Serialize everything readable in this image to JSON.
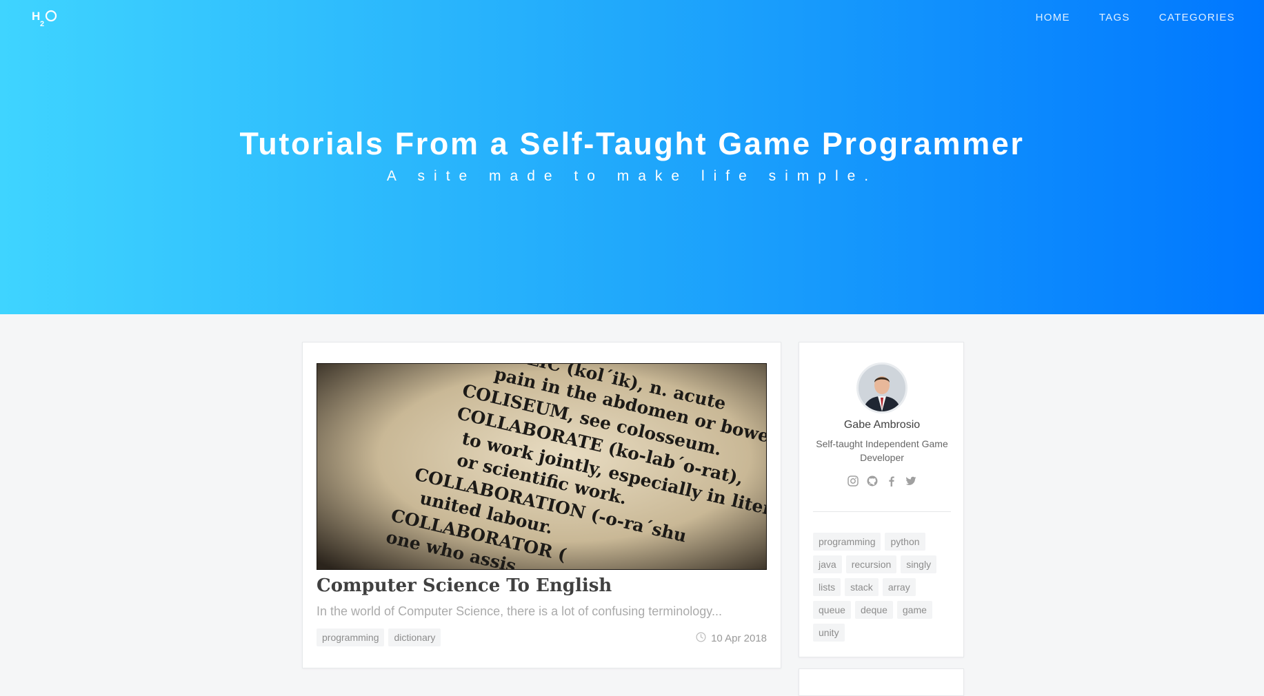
{
  "header": {
    "logo_label": "H2O",
    "nav": [
      {
        "label": "HOME"
      },
      {
        "label": "TAGS"
      },
      {
        "label": "CATEGORIES"
      }
    ],
    "title": "Tutorials From a Self-Taught Game Programmer",
    "subtitle": "A site made to make life simple.",
    "gradient": [
      "#3fd4ff",
      "#0077ff"
    ]
  },
  "post": {
    "image_lines": [
      "COLIC (kol´ik), n. acute",
      "pain in the abdomen or bowels",
      "COLISEUM, see colosseum.",
      "COLLABORATE (ko-lab´o-rat),",
      "to work jointly, especially in liter",
      "or scientific work.",
      "COLLABORATION (-o-ra´shu",
      "united labour.",
      "COLLABORATOR (",
      "one who assis"
    ],
    "title": "Computer Science To English",
    "excerpt": "In the world of Computer Science, there is a lot of confusing terminology...",
    "tags": [
      "programming",
      "dictionary"
    ],
    "date": "10 Apr 2018"
  },
  "profile": {
    "name": "Gabe Ambrosio",
    "description": "Self-taught Independent Game Developer",
    "social_icons": [
      "instagram-icon",
      "github-icon",
      "facebook-icon",
      "twitter-icon"
    ],
    "tags": [
      "programming",
      "python",
      "java",
      "recursion",
      "singly",
      "lists",
      "stack",
      "array",
      "queue",
      "deque",
      "game",
      "unity"
    ]
  }
}
